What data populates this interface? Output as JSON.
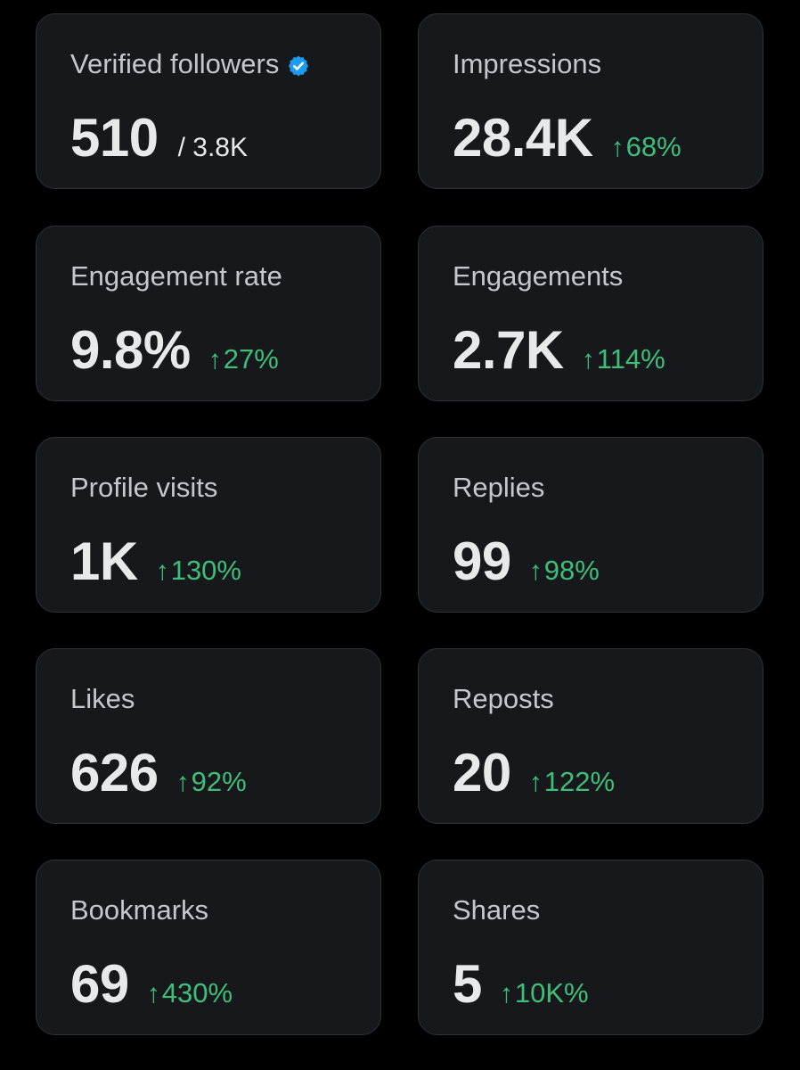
{
  "colors": {
    "background": "#000000",
    "card": "#16181c",
    "card_border": "#2f3336",
    "label": "#c4c8cc",
    "value": "#e7e9ea",
    "positive_change": "#3fbe7a",
    "verified_badge": "#1d9bf0"
  },
  "icons": {
    "verified": "verified-badge-icon",
    "trend": "arrow-up-icon"
  },
  "arrow_glyph": "↑",
  "cards": {
    "verified_followers": {
      "label": "Verified followers",
      "value": "510",
      "total": "/ 3.8K"
    },
    "impressions": {
      "label": "Impressions",
      "value": "28.4K",
      "change": "68%"
    },
    "engagement_rate": {
      "label": "Engagement rate",
      "value": "9.8%",
      "change": "27%"
    },
    "engagements": {
      "label": "Engagements",
      "value": "2.7K",
      "change": "114%"
    },
    "profile_visits": {
      "label": "Profile visits",
      "value": "1K",
      "change": "130%"
    },
    "replies": {
      "label": "Replies",
      "value": "99",
      "change": "98%"
    },
    "likes": {
      "label": "Likes",
      "value": "626",
      "change": "92%"
    },
    "reposts": {
      "label": "Reposts",
      "value": "20",
      "change": "122%"
    },
    "bookmarks": {
      "label": "Bookmarks",
      "value": "69",
      "change": "430%"
    },
    "shares": {
      "label": "Shares",
      "value": "5",
      "change": "10K%"
    }
  }
}
